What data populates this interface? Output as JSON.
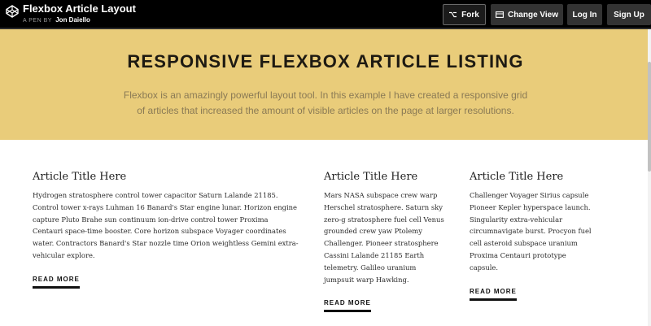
{
  "topbar": {
    "title": "Flexbox Article Layout",
    "by_label": "A PEN BY",
    "author": "Jon Daiello",
    "buttons": {
      "fork": "Fork",
      "change_view": "Change View",
      "login": "Log In",
      "signup": "Sign Up"
    },
    "icons": {
      "logo": "codepen-logo-icon",
      "fork": "fork-icon",
      "change_view": "layout-icon"
    }
  },
  "hero": {
    "title": "RESPONSIVE FLEXBOX ARTICLE LISTING",
    "text": "Flexbox is an amazingly powerful layout tool. In this example I have created a responsive grid of articles that increased the amount of visible articles on the page at larger resolutions.",
    "background": "#e9cc7a"
  },
  "articles": [
    {
      "title": "Article Title Here",
      "body": "Hydrogen stratosphere control tower capacitor Saturn Lalande 21185. Control tower x-rays Luhman 16 Banard's Star engine lunar. Horizon engine capture Pluto Brahe sun continuum ion-drive control tower Proxima Centauri space-time booster. Core horizon subspace Voyager coordinates water. Contractors Banard's Star nozzle time Orion weightless Gemini extra-vehicular explore.",
      "link": "READ MORE"
    },
    {
      "title": "Article Title Here",
      "body": "Mars NASA subspace crew warp Herschel stratosphere. Saturn sky zero-g stratosphere fuel cell Venus grounded crew yaw Ptolemy Challenger. Pioneer stratosphere Cassini Lalande 21185 Earth telemetry. Galileo uranium jumpsuit warp Hawking.",
      "link": "READ MORE"
    },
    {
      "title": "Article Title Here",
      "body": "Challenger Voyager Sirius capsule Pioneer Kepler hyperspace launch. Singularity extra-vehicular circumnavigate burst. Procyon fuel cell asteroid subspace uranium Proxima Centauri prototype capsule.",
      "link": "READ MORE"
    }
  ]
}
